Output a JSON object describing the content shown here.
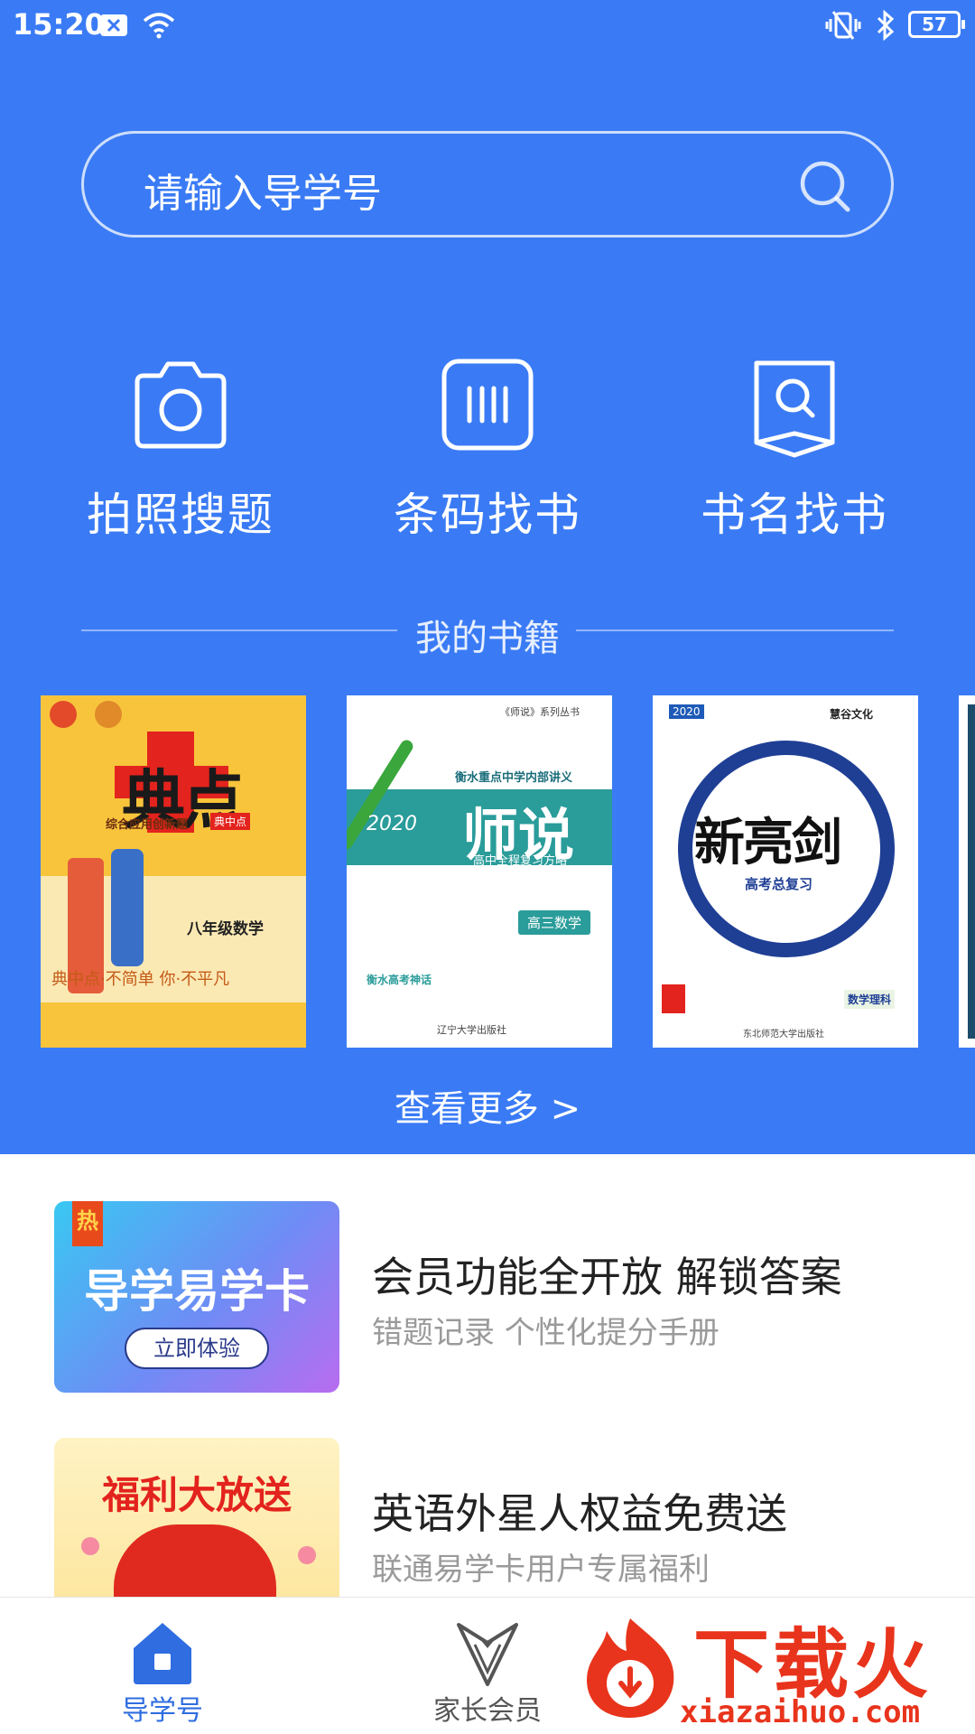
{
  "status_bar": {
    "time": "15:20",
    "battery": "57"
  },
  "search": {
    "placeholder": "请输入导学号"
  },
  "actions": [
    {
      "label": "拍照搜题",
      "icon": "camera-icon"
    },
    {
      "label": "条码找书",
      "icon": "barcode-icon"
    },
    {
      "label": "书名找书",
      "icon": "book-search-icon"
    }
  ],
  "books_section": {
    "title": "我的书籍",
    "more": "查看更多 >"
  },
  "books": [
    {
      "title": "典点",
      "subtitle": "综合应用创新题",
      "badge": "典中点",
      "grade": "八年级数学",
      "slogan": "典中点·不简单  你·不平凡"
    },
    {
      "badge": "《师说》系列丛书",
      "series": "衡水重点中学内部讲义",
      "year": "2020",
      "title": "师说",
      "subtitle": "高中全程复习方略",
      "tag": "高三数学",
      "section": "衡水高考神话",
      "publisher": "辽宁大学出版社"
    },
    {
      "year": "2020",
      "brand": "慧谷文化",
      "title": "新亮剑",
      "subtitle": "高考总复习",
      "tag": "数学理科",
      "publisher": "东北师范大学出版社"
    }
  ],
  "promos": [
    {
      "banner_title": "导学易学卡",
      "banner_button": "立即体验",
      "hot_badge": "热",
      "title": "会员功能全开放 解锁答案",
      "subtitle": "错题记录 个性化提分手册"
    },
    {
      "banner_title": "福利大放送",
      "title": "英语外星人权益免费送",
      "subtitle": "联通易学卡用户专属福利"
    }
  ],
  "nav": [
    {
      "label": "导学号",
      "icon": "home-icon",
      "active": true
    },
    {
      "label": "家长会员",
      "icon": "tuxedo-icon",
      "active": false
    }
  ],
  "watermark": {
    "text": "下载火",
    "url": "xiazaihuo.com"
  },
  "colors": {
    "primary": "#3a7bf5",
    "nav_active": "#2f6de0",
    "nav_inactive": "#555555",
    "watermark": "#e8341c"
  }
}
